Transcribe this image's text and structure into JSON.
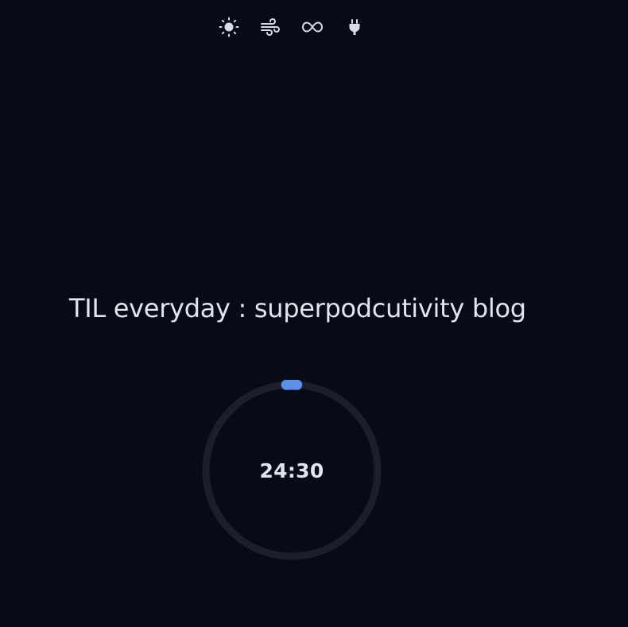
{
  "toolbar": {
    "items": [
      {
        "icon": "sun-icon"
      },
      {
        "icon": "wind-icon"
      },
      {
        "icon": "infinity-icon"
      },
      {
        "icon": "plug-icon"
      }
    ]
  },
  "main": {
    "task_title": "TIL everyday : superpodcutivity blog"
  },
  "timer": {
    "display": "24:30",
    "progress_fraction": 0.02
  },
  "colors": {
    "background": "#070a17",
    "ring_track": "#1c1f2b",
    "ring_progress": "#5b8fe8",
    "text": "#e3e5ec"
  }
}
